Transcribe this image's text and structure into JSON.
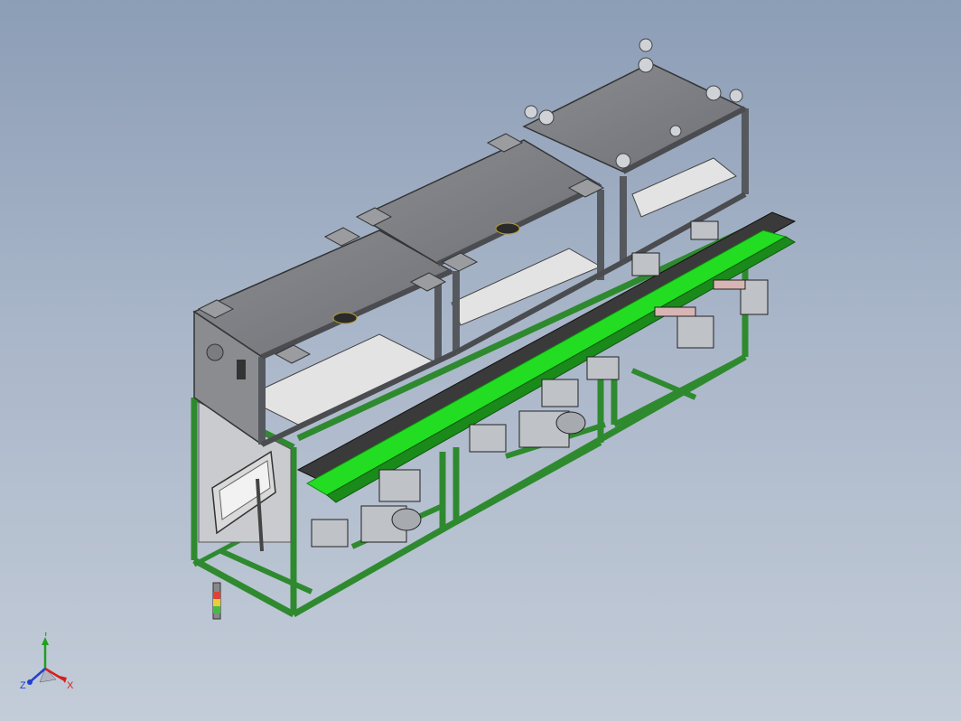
{
  "viewport": {
    "background_top": "#8c9db6",
    "background_bottom": "#c3ccd8"
  },
  "model": {
    "description_icon": "isometric-cad-assembly",
    "frame_color": "#2f8a2f",
    "conveyor_color": "#22dd22",
    "enclosure_color": "#7d7f84",
    "panel_color": "#e3e3e3"
  },
  "triad": {
    "x_label": "X",
    "y_label": "Y",
    "z_label": "Z",
    "x_color": "#d42020",
    "y_color": "#20a020",
    "z_color": "#2040d0"
  }
}
